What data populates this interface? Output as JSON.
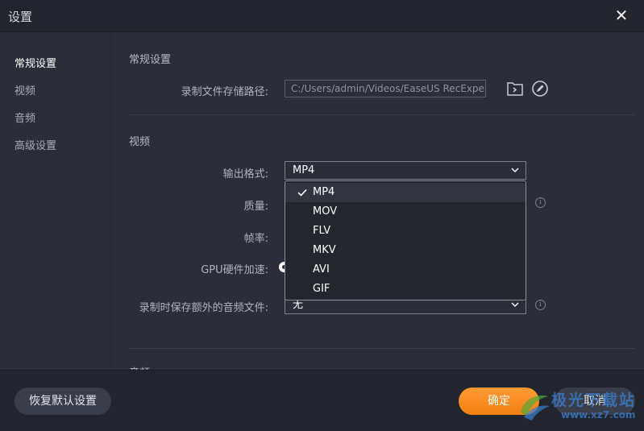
{
  "window": {
    "title": "设置",
    "close_glyph": "✕"
  },
  "sidebar": {
    "items": [
      {
        "label": "常规设置",
        "active": true
      },
      {
        "label": "视频",
        "active": false
      },
      {
        "label": "音频",
        "active": false
      },
      {
        "label": "高级设置",
        "active": false
      }
    ]
  },
  "general": {
    "title": "常规设置",
    "path_label": "录制文件存储路径:",
    "path_value": "C:/Users/admin/Videos/EaseUS RecExperts"
  },
  "video": {
    "title": "视频",
    "format_label": "输出格式:",
    "format_value": "MP4",
    "quality_label": "质量:",
    "framerate_label": "帧率:",
    "gpu_label": "GPU硬件加速:",
    "extra_audio_label": "录制时保存额外的音频文件:",
    "extra_audio_value": "无"
  },
  "format_dropdown": {
    "options": [
      "MP4",
      "MOV",
      "FLV",
      "MKV",
      "AVI",
      "GIF"
    ],
    "selected": "MP4"
  },
  "audio": {
    "title": "音频"
  },
  "footer": {
    "reset_label": "恢复默认设置",
    "ok_label": "确定",
    "cancel_label": "取消"
  },
  "watermark": {
    "line1": "极光下载站",
    "line2": "www.xz7.com"
  },
  "colors": {
    "accent": "#f58a1f",
    "background": "#2b2e38"
  }
}
